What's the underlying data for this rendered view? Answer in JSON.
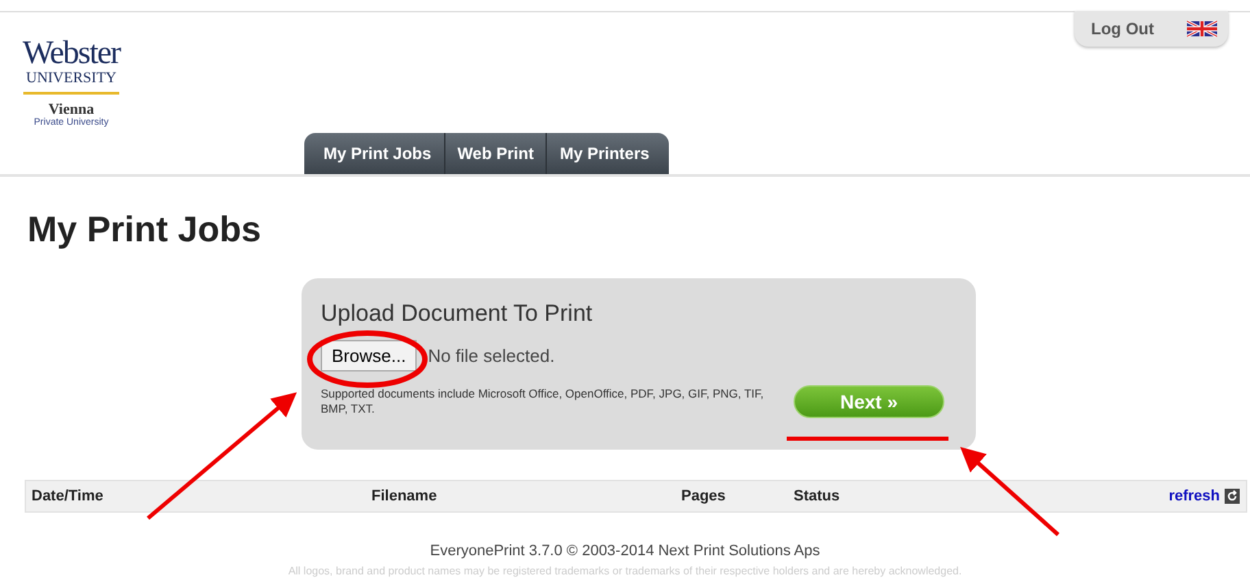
{
  "logo": {
    "name": "Webster",
    "subtitle": "UNIVERSITY",
    "campus": "Vienna",
    "tagline": "Private University"
  },
  "header": {
    "logout": "Log Out"
  },
  "tabs": [
    {
      "label": "My Print Jobs"
    },
    {
      "label": "Web Print"
    },
    {
      "label": "My Printers"
    }
  ],
  "page_title": "My Print Jobs",
  "upload": {
    "title": "Upload Document To Print",
    "browse_button": "Browse...",
    "file_status": "No file selected.",
    "note": "Supported documents include Microsoft Office, OpenOffice, PDF, JPG, GIF, PNG, TIF, BMP, TXT.",
    "next_button": "Next »"
  },
  "table": {
    "columns": [
      "Date/Time",
      "Filename",
      "Pages",
      "Status"
    ],
    "refresh": "refresh"
  },
  "footer": {
    "line": "EveryonePrint 3.7.0 © 2003-2014 Next Print Solutions Aps",
    "disclaimer": "All logos, brand and product names may be registered trademarks or trademarks of their respective holders and are hereby acknowledged."
  }
}
